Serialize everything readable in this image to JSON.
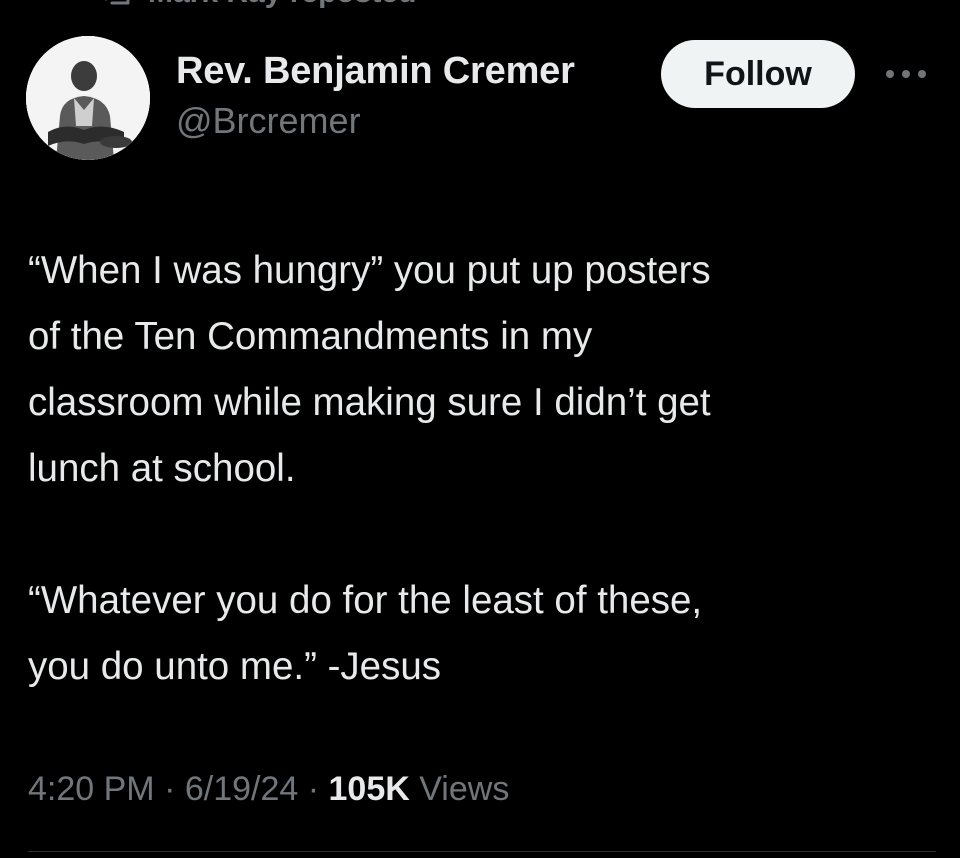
{
  "repost": {
    "text": "Mark Ray reposted"
  },
  "author": {
    "name": "Rev. Benjamin Cremer",
    "handle": "@Brcremer"
  },
  "follow_button_label": "Follow",
  "more_icon": "more-horizontal-icon",
  "tweet": {
    "paragraphs": [
      "“When I was hungry” you put up posters\nof the Ten Commandments in my\nclassroom while making sure I didn’t get\nlunch at school.",
      "“Whatever you do for the least of these,\nyou do unto me.” -Jesus"
    ]
  },
  "meta": {
    "time": "4:20 PM",
    "separator": " · ",
    "date": "6/19/24",
    "views_count": "105K",
    "views_label": " Views"
  },
  "colors": {
    "background": "#000000",
    "primary_text": "#e7e9ea",
    "secondary_text": "#71767b",
    "button_bg": "#eff3f4",
    "button_text": "#0f1419",
    "divider": "#2f3336"
  }
}
